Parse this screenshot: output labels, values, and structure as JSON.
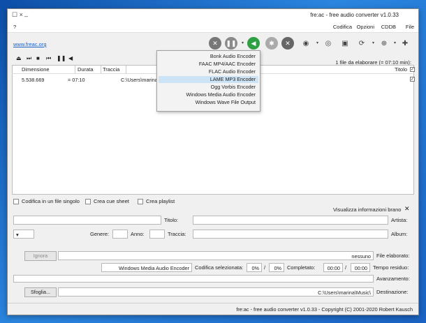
{
  "window": {
    "title": "fre:ac - free audio converter v1.0.33",
    "minimize": "_",
    "close": "☐ ×"
  },
  "menu": {
    "items": [
      "File",
      "CDDB",
      "Opzioni",
      "Codifica"
    ],
    "help": "?"
  },
  "toolbar": {
    "website_link": "www.freac.org"
  },
  "encoder_menu": {
    "items": [
      "Bonk Audio Encoder",
      "FAAC MP4/AAC Encoder",
      "FLAC Audio Encoder",
      "LAME MP3 Encoder",
      "Ogg Vorbis Encoder",
      "Windows Media Audio Encoder",
      "Windows Wave File Output"
    ],
    "selected_index": 3
  },
  "tracklist": {
    "summary": "1 file da elaborare (= 07:10 min):",
    "columns": {
      "title": "Titolo",
      "track": "Traccia",
      "duration": "Durata",
      "size": "Dimensione"
    },
    "rows": [
      {
        "title": "C:\\Users\\marina\\Desktop\\Beethoven_Moonlight_Sonat",
        "duration": "= 07:10",
        "size": "5.538.669"
      }
    ]
  },
  "options": {
    "create_playlist": "Crea playlist",
    "create_cue": "Crea cue sheet",
    "single_file": "Codifica in un file singolo",
    "show_info": "Visualizza informazioni brano"
  },
  "track_info": {
    "artist_label": "Artista:",
    "title_label": "Titolo:",
    "album_label": "Album:",
    "track_label": "Traccia:",
    "year_label": "Anno:",
    "genre_label": "Genere:",
    "genre_arrow": "▾"
  },
  "progress": {
    "file_label": "File elaborato:",
    "file_value": "nessuno",
    "ignore_button": "Ignora",
    "time_label": "Tempo residuo:",
    "time_value": "00:00",
    "time_sep": "/",
    "time_total": "00:00",
    "completed_label": "Completato:",
    "completed_pct": "0%",
    "completed_sep": "/",
    "completed_total": "0%",
    "encoder_label": "Codifica selezionata:",
    "encoder_value": "Windows Media Audio Encoder",
    "progress_label": "Avanzamento:",
    "progress_fraction": 0,
    "destination_label": "Destinazione:",
    "destination_value": "C:\\Users\\marina\\Music\\",
    "browse_button": "Sfoglia..."
  },
  "statusbar": {
    "text": "fre:ac - free audio converter v1.0.33 - Copyright (C) 2001-2020 Robert Kausch"
  }
}
